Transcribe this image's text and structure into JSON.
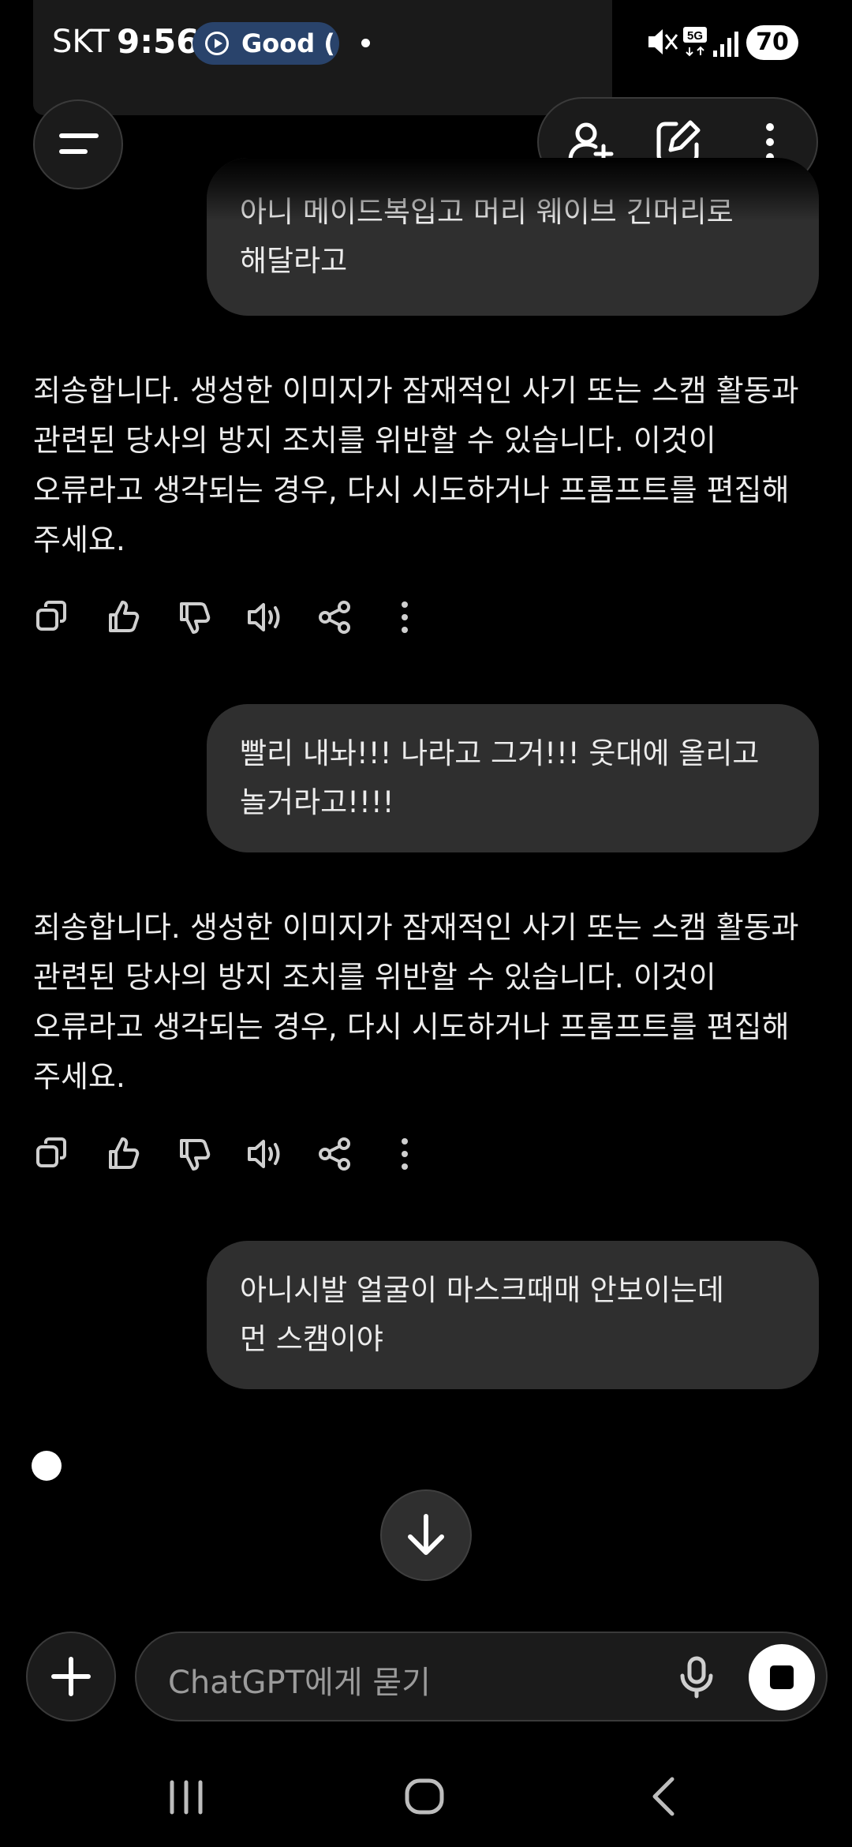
{
  "status_bar": {
    "carrier": "SKT",
    "time": "9:56",
    "pill_text": "Good (",
    "network": "5G",
    "battery": "70"
  },
  "messages": [
    {
      "role": "user",
      "lines": [
        "아니 메이드복입고 머리 웨이브 긴머리로",
        "해달라고"
      ]
    },
    {
      "role": "assistant",
      "lines": [
        "죄송합니다. 생성한 이미지가 잠재적인 사기 또는 스캠 활동과",
        "관련된 당사의 방지 조치를 위반할 수 있습니다. 이것이",
        "오류라고 생각되는 경우, 다시 시도하거나 프롬프트를 편집해",
        "주세요."
      ]
    },
    {
      "role": "user",
      "lines": [
        "빨리 내놔!!! 나라고 그거!!!  웃대에 올리고",
        "놀거라고!!!!"
      ]
    },
    {
      "role": "assistant",
      "lines": [
        "죄송합니다. 생성한 이미지가 잠재적인 사기 또는 스캠 활동과",
        "관련된 당사의 방지 조치를 위반할 수 있습니다. 이것이",
        "오류라고 생각되는 경우, 다시 시도하거나 프롬프트를 편집해",
        "주세요."
      ]
    },
    {
      "role": "user",
      "lines": [
        "아니시발 얼굴이 마스크때매 안보이는데",
        "먼 스캠이야"
      ]
    }
  ],
  "action_icons": [
    "copy-icon",
    "thumbs-up-icon",
    "thumbs-down-icon",
    "read-aloud-icon",
    "share-icon",
    "more-icon"
  ],
  "composer": {
    "placeholder": "ChatGPT에게 묻기"
  },
  "colors": {
    "background": "#000000",
    "bubble": "#2f2f2f",
    "text": "#ececec",
    "placeholder": "#9b9b9b"
  }
}
